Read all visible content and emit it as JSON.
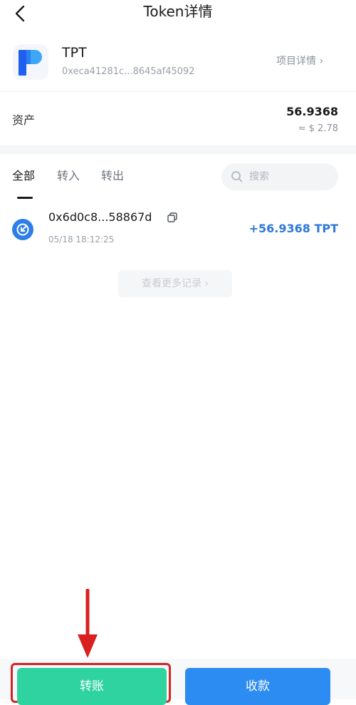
{
  "header": {
    "title": "Token详情",
    "back_icon": "chevron-left-icon"
  },
  "token": {
    "name": "TPT",
    "address": "0xeca41281c...8645af45092",
    "project_link": "项目详情 ›",
    "logo_icon": "tpt-logo",
    "logo_colors": [
      "#1e5ff0",
      "#3ba7f5"
    ]
  },
  "assets": {
    "label": "资产",
    "amount": "56.9368",
    "fiat": "≈ $ 2.78"
  },
  "tabs": [
    {
      "label": "全部",
      "active": true
    },
    {
      "label": "转入",
      "active": false
    },
    {
      "label": "转出",
      "active": false
    }
  ],
  "search": {
    "placeholder": "搜索",
    "icon": "search-icon"
  },
  "transactions": [
    {
      "hash": "0x6d0c8...58867d",
      "time": "05/18 18:12:25",
      "amount": "+56.9368 TPT",
      "direction": "in",
      "icon": "receive-arrow-icon"
    }
  ],
  "more_records": "查看更多记录 ›",
  "actions": {
    "transfer_label": "转账",
    "receive_label": "收款"
  },
  "colors": {
    "transfer": "#2fd3a0",
    "receive": "#2c8cf2",
    "amount_in": "#2d78d9",
    "highlight": "#d62323"
  }
}
